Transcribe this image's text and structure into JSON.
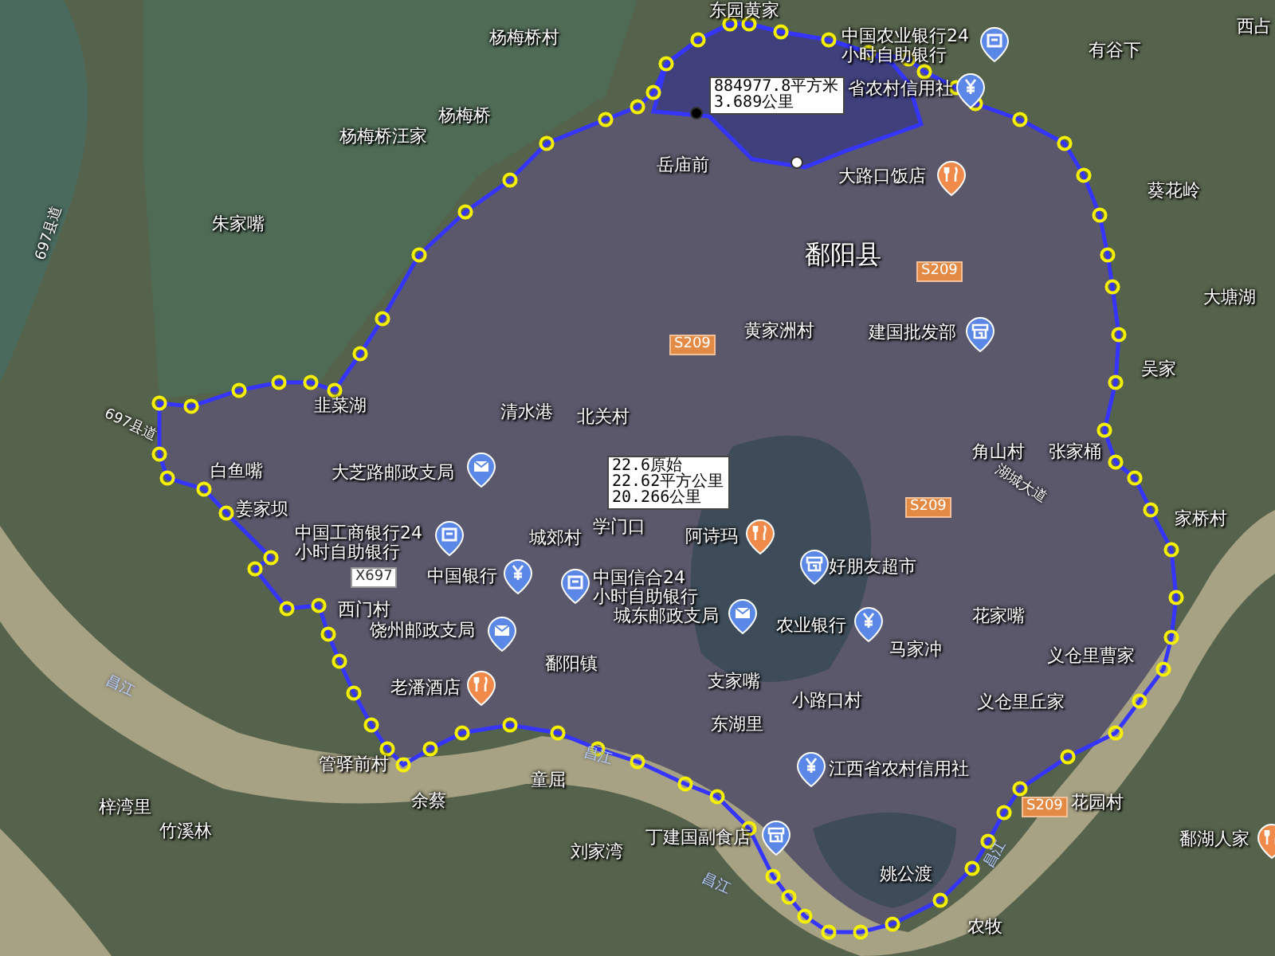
{
  "map": {
    "places": [
      {
        "text": "东园黄家"
      },
      {
        "text": "杨梅桥村"
      },
      {
        "text": "杨梅桥"
      },
      {
        "text": "杨梅桥汪家"
      },
      {
        "text": "朱家嘴"
      },
      {
        "text": "有谷下"
      },
      {
        "text": "西占"
      },
      {
        "text": "岳庙前"
      },
      {
        "text": "葵花岭"
      },
      {
        "text": "鄱阳县"
      },
      {
        "text": "大塘湖"
      },
      {
        "text": "黄家洲村"
      },
      {
        "text": "吴家"
      },
      {
        "text": "韭菜湖"
      },
      {
        "text": "清水港"
      },
      {
        "text": "北关村"
      },
      {
        "text": "角山村"
      },
      {
        "text": "张家桶"
      },
      {
        "text": "白鱼嘴"
      },
      {
        "text": "姜家坝"
      },
      {
        "text": "家桥村"
      },
      {
        "text": "学门口"
      },
      {
        "text": "城郊村"
      },
      {
        "text": "西门村"
      },
      {
        "text": "花家嘴"
      },
      {
        "text": "马家冲"
      },
      {
        "text": "义仓里曹家"
      },
      {
        "text": "鄱阳镇"
      },
      {
        "text": "支家嘴"
      },
      {
        "text": "小路口村"
      },
      {
        "text": "义仓里丘家"
      },
      {
        "text": "东湖里"
      },
      {
        "text": "管驿前村"
      },
      {
        "text": "童屈"
      },
      {
        "text": "梓湾里"
      },
      {
        "text": "余蔡"
      },
      {
        "text": "花园村"
      },
      {
        "text": "竹溪林"
      },
      {
        "text": "刘家湾"
      },
      {
        "text": "姚公渡"
      },
      {
        "text": "农牧"
      }
    ],
    "pois": [
      {
        "lines": [
          "中国农业银行24",
          "小时自助银行"
        ],
        "kind": "bank"
      },
      {
        "lines": [
          "省农村信用社"
        ],
        "kind": "yuan"
      },
      {
        "lines": [
          "大路口饭店"
        ],
        "kind": "restaurant"
      },
      {
        "lines": [
          "建国批发部"
        ],
        "kind": "shop"
      },
      {
        "lines": [
          "大芝路邮政支局"
        ],
        "kind": "post"
      },
      {
        "lines": [
          "中国工商银行24",
          "小时自助银行"
        ],
        "kind": "bank"
      },
      {
        "lines": [
          "中国银行"
        ],
        "kind": "yuan"
      },
      {
        "lines": [
          "中国信合24",
          "小时自助银行"
        ],
        "kind": "bank"
      },
      {
        "lines": [
          "阿诗玛"
        ],
        "kind": "restaurant"
      },
      {
        "lines": [
          "好朋友超市"
        ],
        "kind": "shop"
      },
      {
        "lines": [
          "饶州邮政支局"
        ],
        "kind": "post"
      },
      {
        "lines": [
          "城东邮政支局"
        ],
        "kind": "post"
      },
      {
        "lines": [
          "农业银行"
        ],
        "kind": "yuan"
      },
      {
        "lines": [
          "老潘酒店"
        ],
        "kind": "restaurant"
      },
      {
        "lines": [
          "江西省农村信用社"
        ],
        "kind": "yuan"
      },
      {
        "lines": [
          "丁建国副食店"
        ],
        "kind": "shop"
      },
      {
        "lines": [
          "鄱湖人家"
        ],
        "kind": "restaurant"
      }
    ],
    "roads": [
      {
        "text": "S209",
        "kind": "route"
      },
      {
        "text": "S209",
        "kind": "route"
      },
      {
        "text": "S209",
        "kind": "route"
      },
      {
        "text": "S209",
        "kind": "route"
      },
      {
        "text": "X697",
        "kind": "county"
      },
      {
        "text": "697县道",
        "kind": "road"
      },
      {
        "text": "697县道",
        "kind": "road"
      },
      {
        "text": "湖城大道",
        "kind": "road"
      },
      {
        "text": "昌江",
        "kind": "river"
      },
      {
        "text": "昌江",
        "kind": "river"
      },
      {
        "text": "昌江",
        "kind": "river"
      },
      {
        "text": "昌江",
        "kind": "river"
      }
    ],
    "measurements": [
      {
        "lines": [
          "884977.8平方米",
          "3.689公里"
        ]
      },
      {
        "lines": [
          "22.6原始",
          "22.62平方公里",
          "20.266公里"
        ]
      }
    ]
  }
}
